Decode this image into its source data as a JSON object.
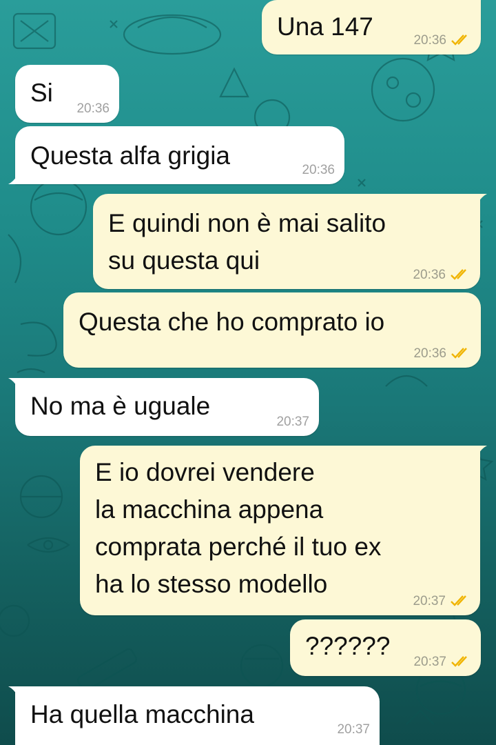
{
  "chat": {
    "colors": {
      "background_top": "#2a9d9a",
      "background_bottom": "#0f4c4c",
      "outgoing_bubble": "#fdf8d6",
      "incoming_bubble": "#ffffff",
      "read_ticks": "#f0b400"
    },
    "messages": [
      {
        "direction": "outgoing",
        "text": "Una 147",
        "time": "20:36",
        "status": "read"
      },
      {
        "direction": "incoming",
        "text": "Si",
        "time": "20:36"
      },
      {
        "direction": "incoming",
        "text": "Questa alfa grigia",
        "time": "20:36"
      },
      {
        "direction": "outgoing",
        "text": "E quindi non è mai salito\nsu questa qui",
        "time": "20:36",
        "status": "read"
      },
      {
        "direction": "outgoing",
        "text": "Questa che ho comprato io",
        "time": "20:36",
        "status": "read"
      },
      {
        "direction": "incoming",
        "text": "No ma è uguale",
        "time": "20:37"
      },
      {
        "direction": "outgoing",
        "text": "E io dovrei vendere\nla macchina appena\ncomprata perché il tuo ex\nha lo stesso modello",
        "time": "20:37",
        "status": "read"
      },
      {
        "direction": "outgoing",
        "text": "??????",
        "time": "20:37",
        "status": "read"
      },
      {
        "direction": "incoming",
        "text": "Ha quella macchina",
        "time": "20:37"
      }
    ]
  }
}
